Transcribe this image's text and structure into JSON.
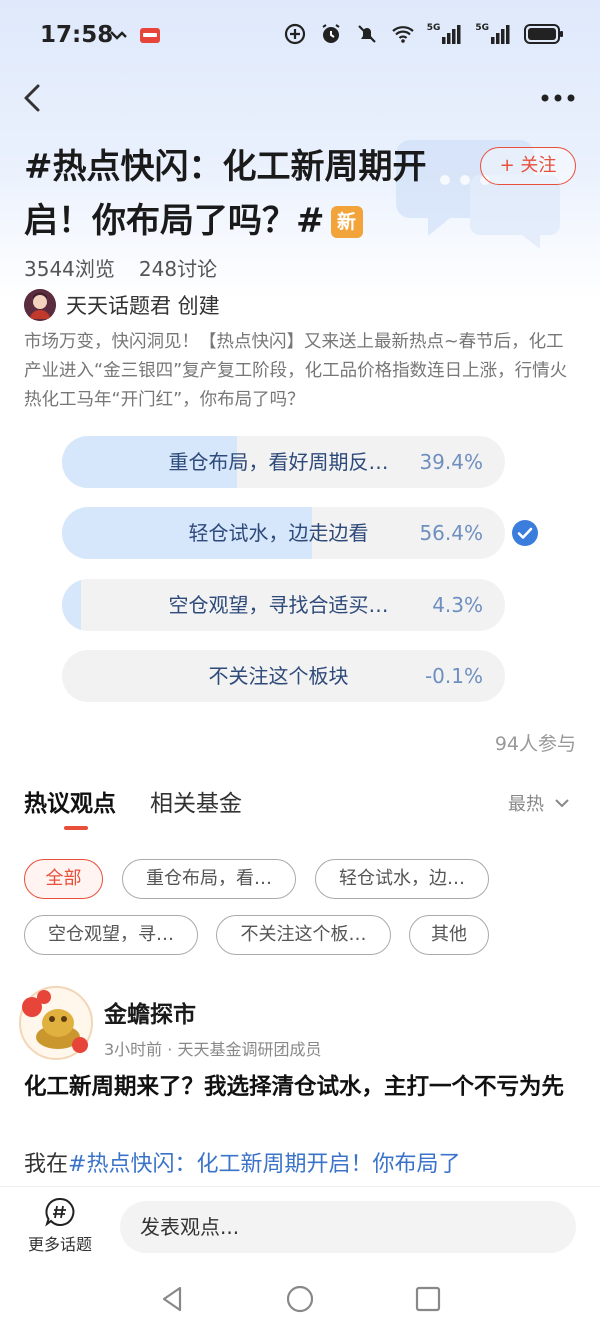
{
  "status_bar": {
    "time": "17:58",
    "icons": [
      "missed-call-icon",
      "app-notification-icon",
      "data-saver-icon",
      "alarm-icon",
      "mute-icon",
      "wifi-icon",
      "5g-signal-icon",
      "5g-signal-icon",
      "battery-icon"
    ],
    "network_labels": [
      "5G",
      "5G"
    ]
  },
  "topic": {
    "title": "#热点快闪：化工新周期开启！你布局了吗？#",
    "new_badge": "新",
    "follow_label": "+ 关注",
    "views": "3544浏览",
    "discussions": "248讨论",
    "creator": "天天话题君 创建",
    "description": "市场万变，快闪洞见！【热点快闪】又来送上最新热点~春节后，化工产业进入“金三银四”复产复工阶段，化工品价格指数连日上涨，行情火热化工马年“开门红”，你布局了吗？"
  },
  "poll": {
    "options": [
      {
        "label": "重仓布局，看好周期反…",
        "percent_text": "39.4%",
        "share": 0.394,
        "selected": false
      },
      {
        "label": "轻仓试水，边走边看",
        "percent_text": "56.4%",
        "share": 0.564,
        "selected": true
      },
      {
        "label": "空仓观望，寻找合适买…",
        "percent_text": "4.3%",
        "share": 0.043,
        "selected": false
      },
      {
        "label": "不关注这个板块",
        "percent_text": "-0.1%",
        "share": 0.0,
        "selected": false
      }
    ],
    "participants": "94人参与"
  },
  "tabs": [
    {
      "label": "热议观点",
      "active": true
    },
    {
      "label": "相关基金",
      "active": false
    }
  ],
  "sort": {
    "label": "最热"
  },
  "filters": [
    {
      "label": "全部",
      "active": true
    },
    {
      "label": "重仓布局，看…",
      "active": false
    },
    {
      "label": "轻仓试水，边…",
      "active": false
    },
    {
      "label": "空仓观望，寻…",
      "active": false
    },
    {
      "label": "不关注这个板…",
      "active": false
    },
    {
      "label": "其他",
      "active": false
    }
  ],
  "post": {
    "author": "金蟾探市",
    "meta": "3小时前 · 天天基金调研团成员",
    "title": "化工新周期来了？我选择清仓试水，主打一个不亏为先",
    "body_prefix": "我在",
    "body_link": "#热点快闪：化工新周期开启！你布局了"
  },
  "bottom_bar": {
    "more_topics": "更多话题",
    "comment_placeholder": "发表观点..."
  },
  "colors": {
    "accent": "#e8503a",
    "poll_fill": "#d6e6fb",
    "poll_text": "#2e4a7a",
    "link": "#3b73c8",
    "check": "#3b7ddd",
    "badge": "#f2a33a"
  }
}
